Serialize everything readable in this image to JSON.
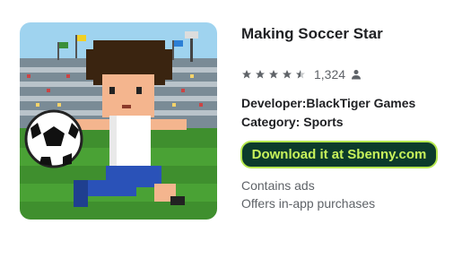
{
  "app": {
    "title": "Making Soccer Star",
    "rating_stars": 4.5,
    "rating_count": "1,324",
    "developer_line": "Developer:BlackTiger Games",
    "category_line": "Category: Sports",
    "download_label": "Download it at Sbenny.com",
    "contains_ads": "Contains ads",
    "in_app": "Offers in-app purchases"
  },
  "icons": {
    "star": "star-icon",
    "person": "person-icon",
    "app_icon": "app-icon-soccer-player"
  },
  "colors": {
    "button_bg": "#0c3b2b",
    "button_border": "#b7e84f",
    "button_text": "#c8f25b",
    "star": "#5f6368"
  }
}
